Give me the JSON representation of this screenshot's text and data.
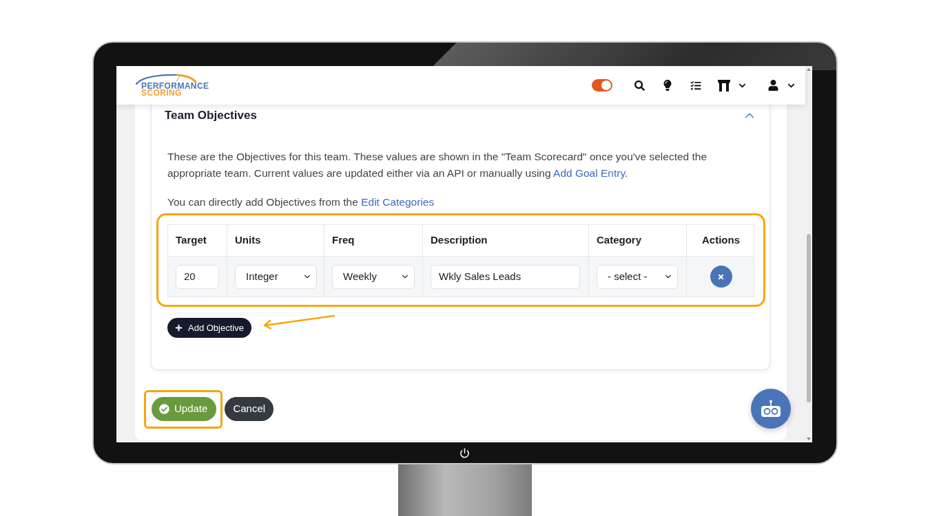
{
  "header": {
    "logo": {
      "line_1": "PERFORMANCE",
      "line_2": "SCORING"
    },
    "mode_toggle": {
      "on": true
    }
  },
  "objectives_section": {
    "title": "Team Objectives",
    "expanded": true,
    "intro": {
      "text": "These are the Objectives for this team. These values are shown in the \"Team Scorecard\" once you've selected the appropriate team. Current values are updated either via an API or manually using ",
      "link": "Add Goal Entry",
      "after": "."
    },
    "note": {
      "text": "You can directly add Objectives from the ",
      "link": "Edit Categories"
    },
    "table": {
      "highlighted": true,
      "columns": [
        "Target",
        "Units",
        "Freq",
        "Description",
        "Category",
        "Actions"
      ],
      "rows": [
        {
          "target": "20",
          "units": "Integer",
          "freq": "Weekly",
          "description": "Wkly Sales Leads",
          "category": "- select -"
        }
      ]
    },
    "add_button": {
      "label": "Add Objective",
      "pointed_at": true
    }
  },
  "buttons": [
    {
      "label": "Update",
      "kind": "primary",
      "highlighted": true
    },
    {
      "label": "Cancel",
      "kind": "secondary",
      "highlighted": false
    }
  ]
}
